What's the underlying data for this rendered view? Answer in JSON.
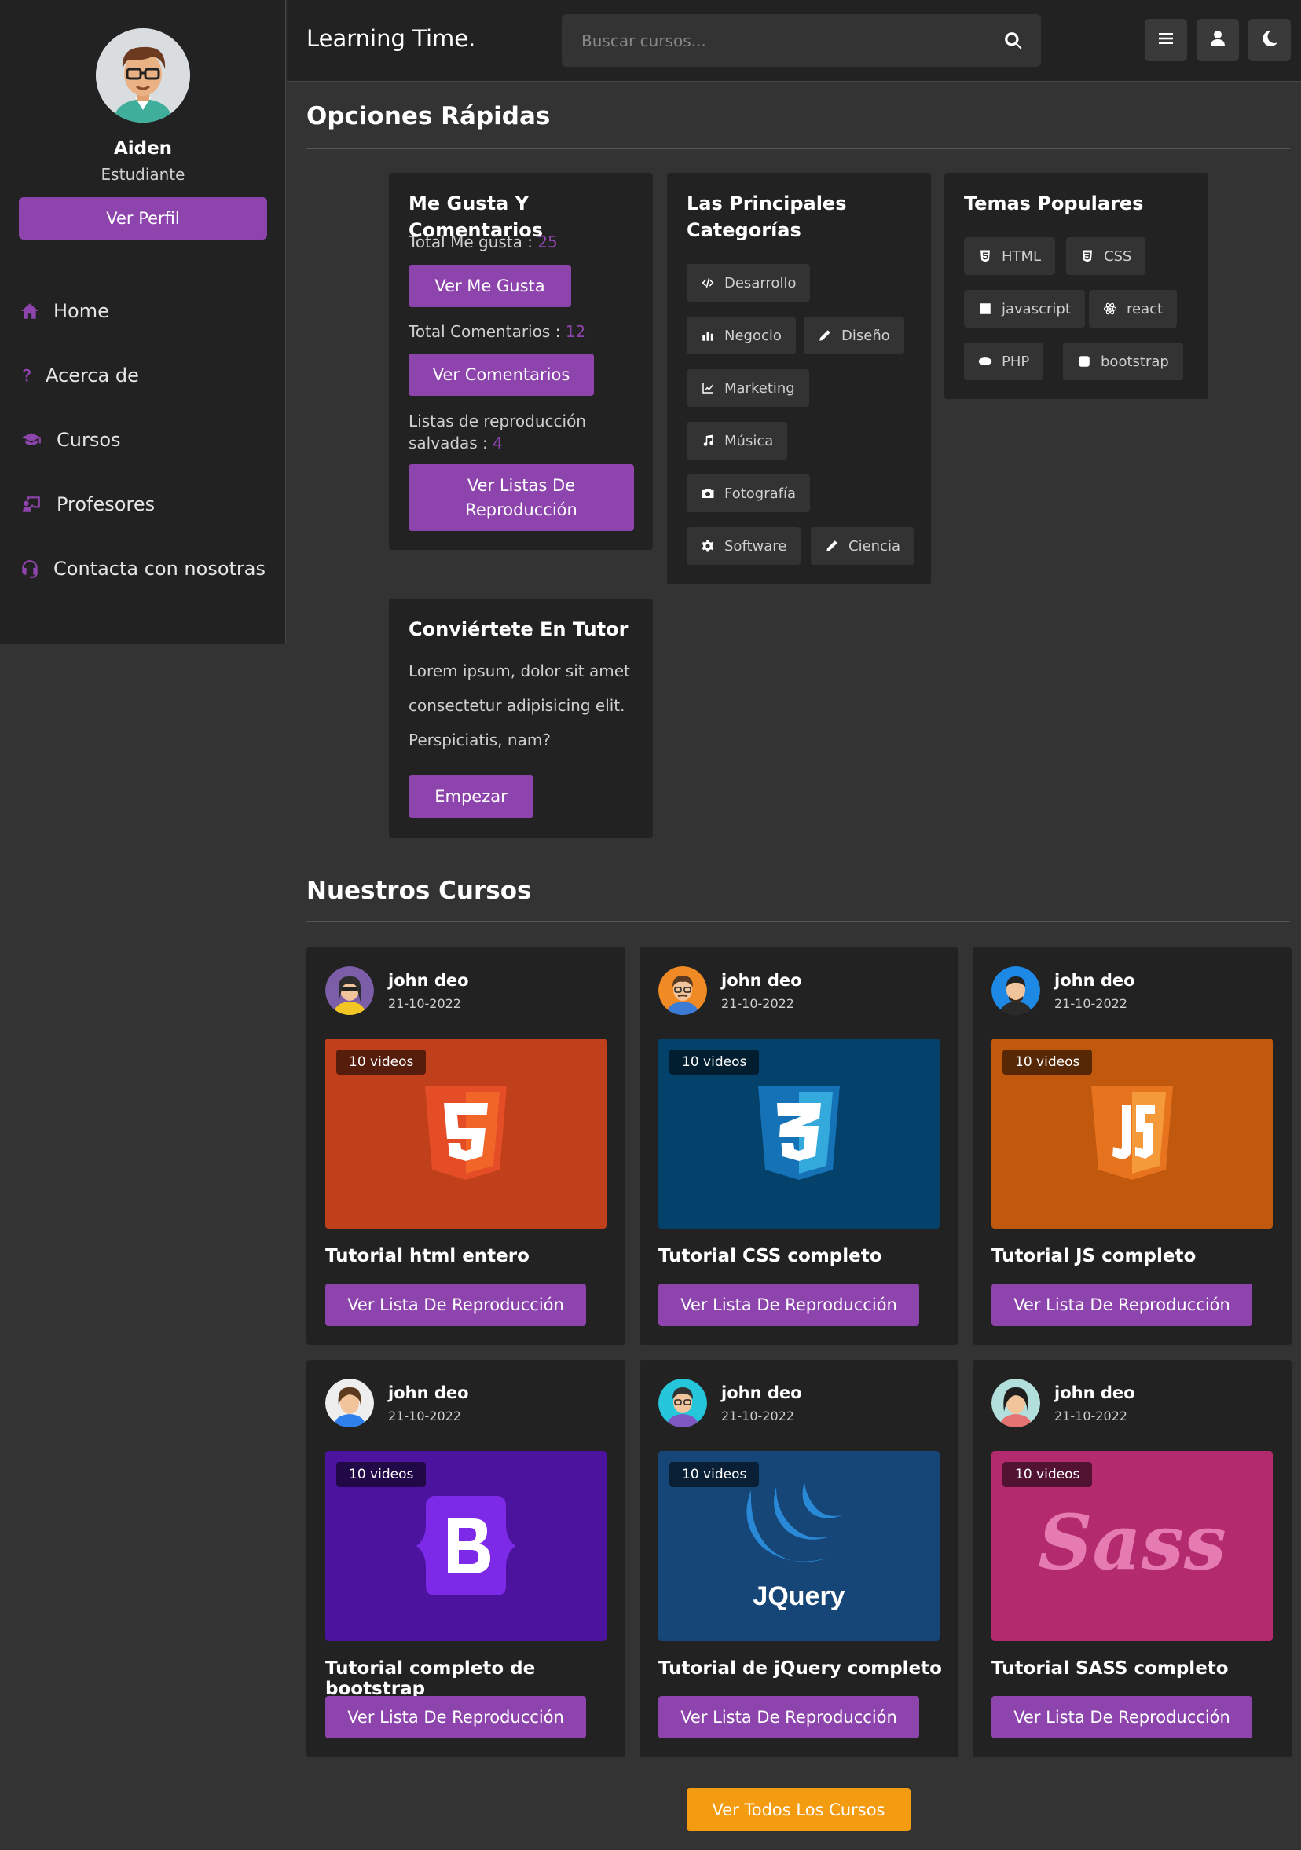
{
  "app": {
    "title": "Learning Time."
  },
  "search": {
    "placeholder": "Buscar cursos..."
  },
  "header": {
    "icons": [
      "menu-icon",
      "user-icon",
      "moon-icon"
    ]
  },
  "profile": {
    "name": "Aiden",
    "role": "Estudiante",
    "button": "Ver Perfil"
  },
  "nav": [
    {
      "label": "Home",
      "icon": "home-icon"
    },
    {
      "label": "Acerca de",
      "icon": "question-icon"
    },
    {
      "label": "Cursos",
      "icon": "graduation-cap-icon"
    },
    {
      "label": "Profesores",
      "icon": "chalkboard-teacher-icon"
    },
    {
      "label": "Contacta con nosotras",
      "icon": "headset-icon"
    }
  ],
  "quick": {
    "title": "Opciones Rápidas",
    "likes": {
      "title": "Me Gusta Y Comentarios",
      "likes_label": "Total Me gusta : ",
      "likes_value": "25",
      "likes_button": "Ver Me Gusta",
      "comments_label": "Total Comentarios : ",
      "comments_value": "12",
      "comments_button": "Ver Comentarios",
      "playlists_label": "Listas de reproducción salvadas : ",
      "playlists_value": "4",
      "playlists_button": "Ver Listas De Reproducción"
    },
    "categories": {
      "title": "Las Principales Categorías",
      "items": [
        {
          "label": "Desarrollo",
          "icon": "code-icon"
        },
        {
          "label": "Negocio",
          "icon": "chart-bar-icon"
        },
        {
          "label": "Diseño",
          "icon": "pen-icon"
        },
        {
          "label": "Marketing",
          "icon": "chart-line-icon"
        },
        {
          "label": "Música",
          "icon": "music-icon"
        },
        {
          "label": "Fotografía",
          "icon": "camera-icon"
        },
        {
          "label": "Software",
          "icon": "cog-icon"
        },
        {
          "label": "Ciencia",
          "icon": "pen-icon"
        }
      ]
    },
    "topics": {
      "title": "Temas Populares",
      "items": [
        {
          "label": "HTML",
          "icon": "html5-icon"
        },
        {
          "label": "CSS",
          "icon": "css3-icon"
        },
        {
          "label": "javascript",
          "icon": "js-icon"
        },
        {
          "label": "react",
          "icon": "react-icon"
        },
        {
          "label": "PHP",
          "icon": "php-icon"
        },
        {
          "label": "bootstrap",
          "icon": "bootstrap-icon"
        }
      ]
    },
    "tutor": {
      "title": "Conviértete En Tutor",
      "text": "Lorem ipsum, dolor sit amet consectetur adipisicing elit. Perspiciatis, nam?",
      "button": "Empezar"
    }
  },
  "courses": {
    "title": "Nuestros Cursos",
    "items": [
      {
        "author": "john deo",
        "date": "21-10-2022",
        "videos": "10 videos",
        "title": "Tutorial html entero",
        "button": "Ver Lista De Reproducción",
        "thumb_color": "#c1401c",
        "logo": "html5-logo"
      },
      {
        "author": "john deo",
        "date": "21-10-2022",
        "videos": "10 videos",
        "title": "Tutorial CSS completo",
        "button": "Ver Lista De Reproducción",
        "thumb_color": "#04426b",
        "logo": "css3-logo"
      },
      {
        "author": "john deo",
        "date": "21-10-2022",
        "videos": "10 videos",
        "title": "Tutorial JS completo",
        "button": "Ver Lista De Reproducción",
        "thumb_color": "#c0590e",
        "logo": "js-logo"
      },
      {
        "author": "john deo",
        "date": "21-10-2022",
        "videos": "10 videos",
        "title": "Tutorial completo de bootstrap",
        "button": "Ver Lista De Reproducción",
        "thumb_color": "#4b139e",
        "logo": "bootstrap-logo"
      },
      {
        "author": "john deo",
        "date": "21-10-2022",
        "videos": "10 videos",
        "title": "Tutorial de jQuery completo",
        "button": "Ver Lista De Reproducción",
        "thumb_color": "#154677",
        "logo": "jquery-logo",
        "logo_text": "JQuery"
      },
      {
        "author": "john deo",
        "date": "21-10-2022",
        "videos": "10 videos",
        "title": "Tutorial SASS completo",
        "button": "Ver Lista De Reproducción",
        "thumb_color": "#b42a6e",
        "logo": "sass-logo",
        "logo_text": "Sass"
      }
    ],
    "all_button": "Ver Todos Los Cursos"
  },
  "colors": {
    "accent": "#8e44ad",
    "cta": "#f39c12",
    "panel": "#222222",
    "background": "#333333"
  }
}
